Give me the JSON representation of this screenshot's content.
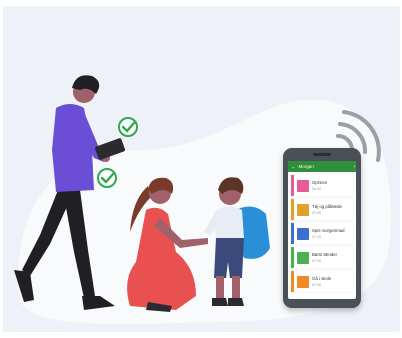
{
  "app": {
    "title": "Morgen",
    "back_icon": "arrow-back-icon",
    "add_icon": "plus-icon"
  },
  "schedule": [
    {
      "label": "Oprsten",
      "time": "06:30",
      "color": "#e85a9a",
      "icon": "wake-up-icon"
    },
    {
      "label": "Tøj og påklæde",
      "time": "07:00",
      "color": "#e0a02a",
      "icon": "clothes-icon"
    },
    {
      "label": "Spis morgenmad",
      "time": "07:15",
      "color": "#3b6fd1",
      "icon": "breakfast-icon"
    },
    {
      "label": "Børst tænder",
      "time": "07:35",
      "color": "#4caf50",
      "icon": "toothbrush-icon"
    },
    {
      "label": "Gå i skole",
      "time": "07:45",
      "color": "#f08a24",
      "icon": "school-icon"
    }
  ],
  "colors": {
    "panel": "#eef2f8",
    "check": "#2fa84f",
    "app_bar": "#2f8f3a",
    "dress": "#e8514f",
    "shirt": "#6a4fd6",
    "backpack": "#2a8fd6"
  }
}
